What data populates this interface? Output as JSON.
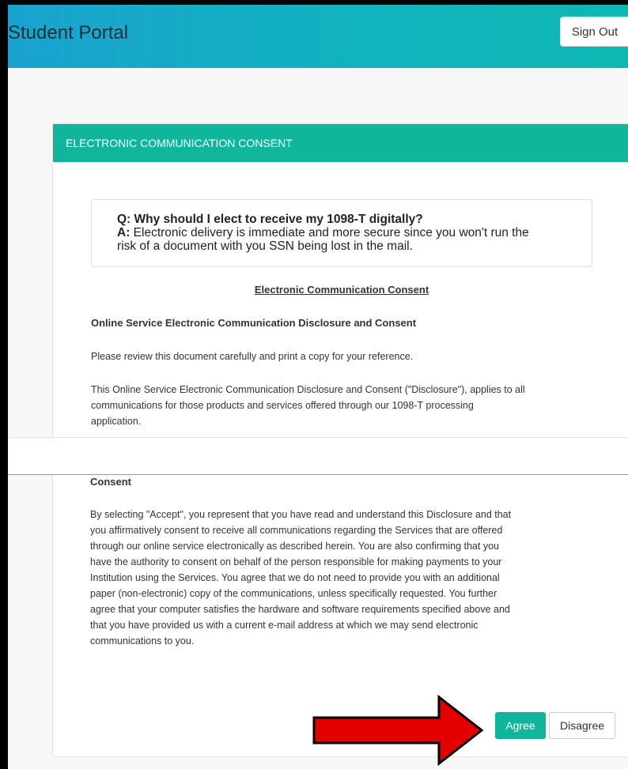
{
  "header": {
    "title": "Student Portal",
    "sign_out": "Sign Out"
  },
  "card": {
    "heading": "ELECTRONIC COMMUNICATION CONSENT",
    "faq": {
      "q_label": "Q:",
      "question": "Why should I elect to receive my 1098-T digitally?",
      "a_label": "A:",
      "answer_line1": "Electronic delivery is immediate and more secure since you won't run the",
      "answer_line2": "risk of a document with you SSN being lost in the mail."
    },
    "doc_title": "Electronic Communication Consent",
    "section_title": "Online Service Electronic Communication Disclosure and Consent",
    "review_line": "Please review this document carefully and print a copy for your reference.",
    "disclosure_lines": [
      "This Online Service Electronic Communication Disclosure and Consent (\"Disclosure\"), applies to all",
      "communications for those products and services offered through our 1098-T processing",
      "application."
    ],
    "consent_heading": "Consent",
    "consent_lines": [
      "By selecting \"Accept\", you represent that you have read and understand this Disclosure and that",
      "you affirmatively consent to receive all communications regarding the Services that are offered",
      "through our online service electronically as described herein. You are also confirming that you",
      "have the authority to consent on behalf of the person responsible for making payments to your",
      "Institution using the Services. You agree that we do not need to provide you with an additional",
      "paper (non-electronic) copy of the communications, unless specifically requested. You further",
      "agree that your computer satisfies the hardware and software requirements specified above and",
      "that you have provided us with a current e-mail address at which we may send electronic",
      "communications to you."
    ]
  },
  "actions": {
    "agree": "Agree",
    "disagree": "Disagree"
  },
  "colors": {
    "accent": "#10b69c",
    "header_start": "#1aa2cf",
    "arrow": "#e20000"
  },
  "annotation": {
    "icon": "red-arrow-icon"
  }
}
